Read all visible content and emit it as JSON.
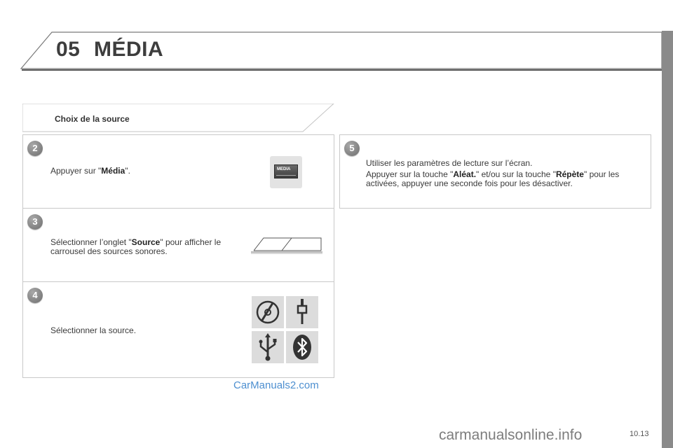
{
  "header": {
    "chapter_number": "05",
    "chapter_title": "MÉDIA"
  },
  "section": {
    "title": "Choix de la source"
  },
  "steps": {
    "s2": {
      "number": "2",
      "text_before": "Appuyer sur \"",
      "keyword": "Média",
      "text_after": "\".",
      "button_label": "MEDIA"
    },
    "s3": {
      "number": "3",
      "text_before": "Sélectionner l’onglet \"",
      "keyword": "Source",
      "text_after": "\" pour afficher le carrousel des sources sonores."
    },
    "s4": {
      "number": "4",
      "text": "Sélectionner la source.",
      "sources": [
        "cd-icon",
        "aux-jack-icon",
        "usb-icon",
        "bluetooth-icon"
      ]
    },
    "s5": {
      "number": "5",
      "line1": "Utiliser les paramètres de lecture sur l’écran.",
      "line2_before": "Appuyer sur la touche \"",
      "keyword1": "Aléat.",
      "line2_mid": "\" et/ou sur la touche \"",
      "keyword2": "Répète",
      "line2_after": "\" pour les activées, appuyer une seconde fois pour les désactiver."
    }
  },
  "watermark": "CarManuals2.com",
  "page_number": "10.13",
  "footer_watermark": "carmanualsonline.info"
}
